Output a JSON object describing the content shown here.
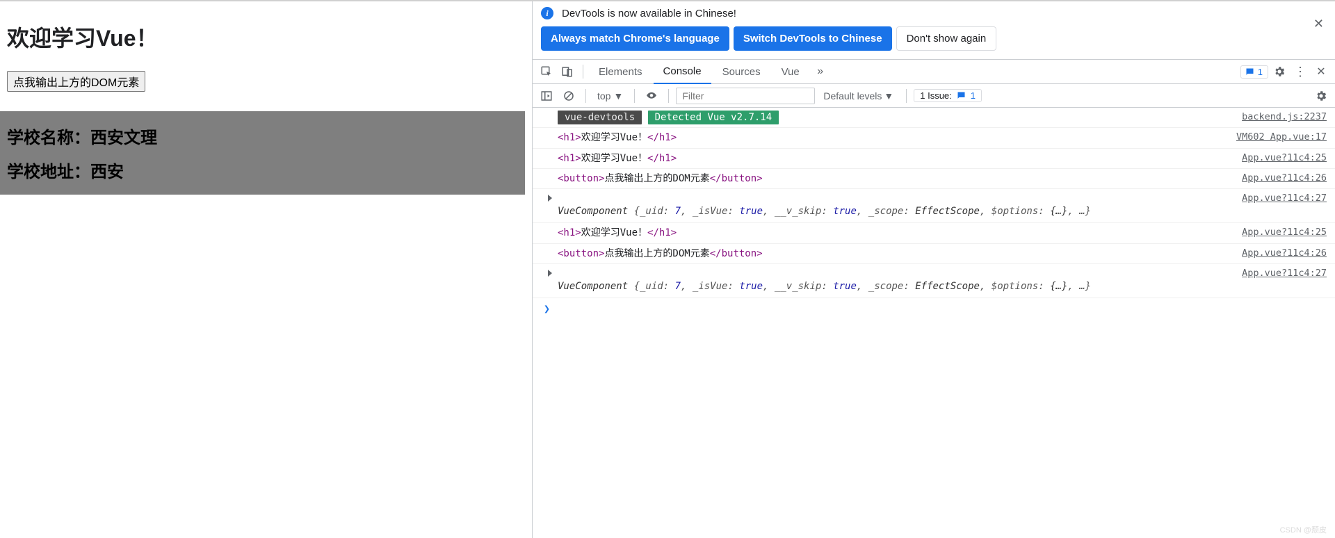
{
  "page": {
    "heading": "欢迎学习Vue！",
    "button": "点我输出上方的DOM元素",
    "school_name_line": "学校名称：西安文理",
    "school_addr_line": "学校地址：西安"
  },
  "banner": {
    "message": "DevTools is now available in Chinese!",
    "always_match": "Always match Chrome's language",
    "switch": "Switch DevTools to Chinese",
    "dont_show": "Don't show again"
  },
  "tabs": {
    "elements": "Elements",
    "console": "Console",
    "sources": "Sources",
    "vue": "Vue",
    "feedback_count": "1"
  },
  "console_bar": {
    "context": "top",
    "filter_placeholder": "Filter",
    "levels": "Default levels",
    "issues_label": "1 Issue:",
    "issues_count": "1"
  },
  "messages": {
    "vuedev_label": "vue-devtools",
    "vuedev_detect": "Detected Vue v2.7.14",
    "vuedev_src": "backend.js:2237",
    "h1_open": "<h1>",
    "h1_text": "欢迎学习Vue！",
    "h1_close": "</h1>",
    "h1_src_a": "VM602 App.vue:17",
    "h1_src_b": "App.vue?11c4:25",
    "btn_open": "<button>",
    "btn_text": "点我输出上方的DOM元素",
    "btn_close": "</button>",
    "btn_src": "App.vue?11c4:26",
    "comp_src": "App.vue?11c4:27",
    "comp_name": "VueComponent ",
    "comp_body_1": "{_uid: ",
    "comp_uid": "7",
    "comp_body_2": ", _isVue: ",
    "comp_isvue": "true",
    "comp_body_3": ", __v_skip: ",
    "comp_skip": "true",
    "comp_body_4": ", _scope: ",
    "comp_scope": "EffectScope",
    "comp_body_5": ", $options: ",
    "comp_opts": "{…}",
    "comp_body_6": ", …}"
  },
  "watermark": "CSDN @颓皮"
}
